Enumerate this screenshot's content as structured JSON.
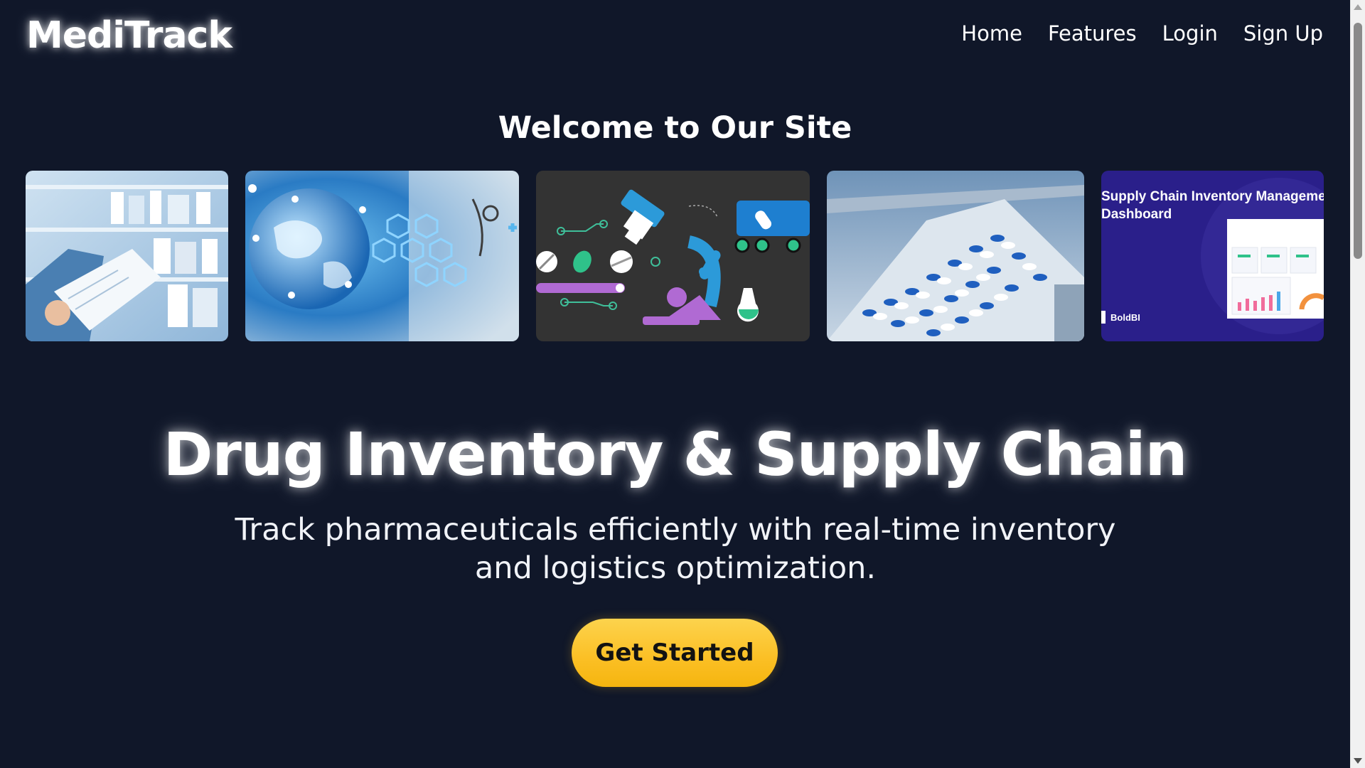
{
  "header": {
    "logo": "MediTrack",
    "nav": [
      "Home",
      "Features",
      "Login",
      "Sign Up"
    ]
  },
  "welcome_title": "Welcome to Our Site",
  "gallery": {
    "images": [
      "pharmacy-shelves-photo",
      "global-health-network-illustration",
      "laboratory-illustration",
      "pill-production-line-photo",
      "supply-chain-dashboard-screenshot"
    ],
    "dashboard_title_line1": "Supply Chain Inventory Manageme",
    "dashboard_title_line2": "Dashboard",
    "dashboard_brand": "BoldBI"
  },
  "hero": {
    "title": "Drug Inventory & Supply Chain",
    "subtitle": "Track pharmaceuticals efficiently with real-time inventory and logistics optimization.",
    "cta": "Get Started"
  },
  "colors": {
    "background": "#101729",
    "accent": "#fbbf24",
    "text": "#ffffff"
  }
}
